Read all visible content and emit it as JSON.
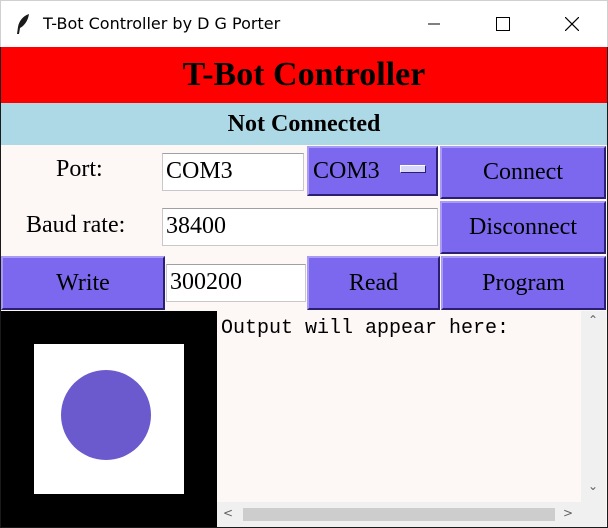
{
  "window": {
    "title": "T-Bot Controller by D G Porter"
  },
  "banner": {
    "title": "T-Bot Controller"
  },
  "status": {
    "text": "Not Connected"
  },
  "port": {
    "label": "Port:",
    "value": "COM3",
    "selected_option": "COM3"
  },
  "baud": {
    "label": "Baud rate:",
    "value": "38400"
  },
  "buttons": {
    "connect": "Connect",
    "disconnect": "Disconnect",
    "write": "Write",
    "read": "Read",
    "program": "Program"
  },
  "write_value": "300200",
  "output": {
    "text": "Output will appear here:"
  },
  "colors": {
    "banner": "#ff0000",
    "status": "#add8e6",
    "button": "#7b68ee",
    "ball": "#6a5acd"
  }
}
